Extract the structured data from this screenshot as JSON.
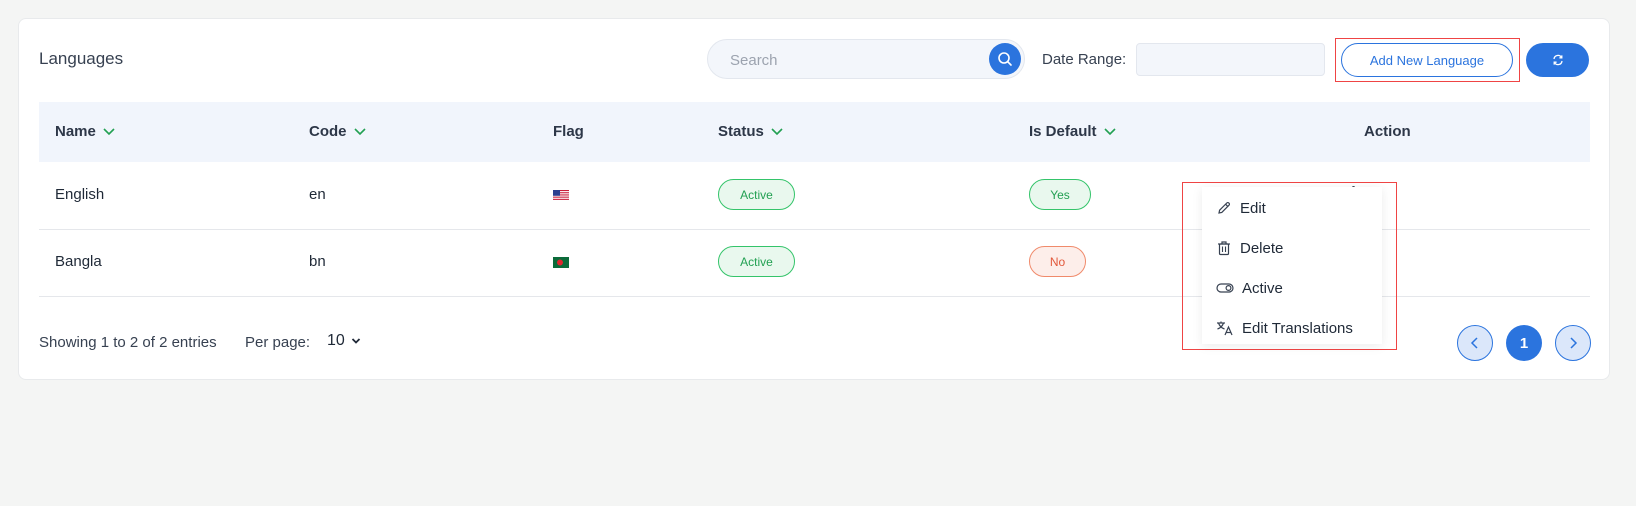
{
  "header": {
    "title": "Languages",
    "search_placeholder": "Search",
    "search_value": "",
    "date_range_label": "Date Range:",
    "date_range_value": "",
    "add_button_label": "Add New Language"
  },
  "table": {
    "columns": [
      "Name",
      "Code",
      "Flag",
      "Status",
      "Is Default",
      "Action"
    ],
    "rows": [
      {
        "name": "English",
        "code": "en",
        "flag": "us-flag-icon",
        "status": "Active",
        "is_default": "Yes"
      },
      {
        "name": "Bangla",
        "code": "bn",
        "flag": "bd-flag-icon",
        "status": "Active",
        "is_default": "No"
      }
    ]
  },
  "action_menu": {
    "items": [
      "Edit",
      "Delete",
      "Active",
      "Edit Translations"
    ],
    "icons": [
      "pencil-icon",
      "trash-icon",
      "toggle-icon",
      "translate-icon"
    ]
  },
  "footer": {
    "showing_text": "Showing 1 to 2 of 2 entries",
    "per_page_label": "Per page:",
    "per_page_value": "10",
    "current_page": "1"
  },
  "colors": {
    "primary": "#2b74de",
    "success": "#22a052",
    "danger": "#e2583b",
    "highlight": "#ef4444"
  }
}
